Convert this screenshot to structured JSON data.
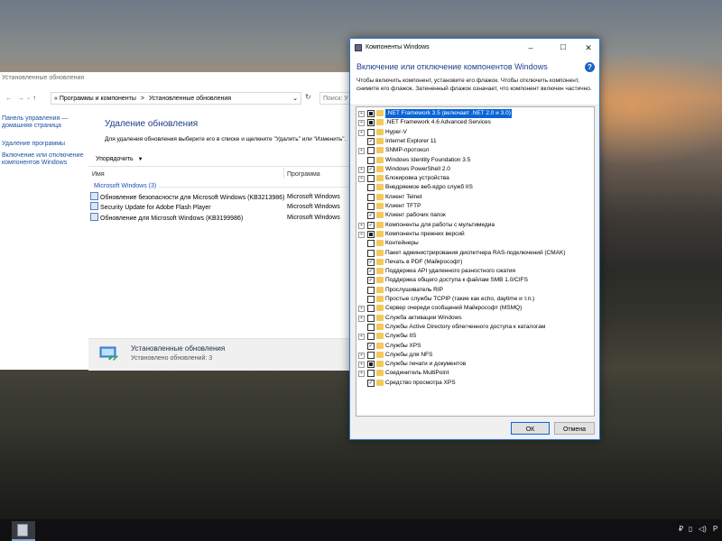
{
  "control_panel": {
    "window_title": "Установленные обновления",
    "breadcrumb_prefix": "«",
    "breadcrumb_1": "Программы и компоненты",
    "breadcrumb_sep": ">",
    "breadcrumb_2": "Установленные обновления",
    "search_placeholder": "Поиск: У",
    "side_links": [
      "Панель управления — домашняя страница",
      "Удаление программы",
      "Включение или отключение компонентов Windows"
    ],
    "heading": "Удаление обновления",
    "description": "Для удаления обновления выберите его в списке и щелкните \"Удалить\" или \"Изменить\".",
    "organize_label": "Упорядочить",
    "columns": {
      "name": "Имя",
      "program": "Программа"
    },
    "group_label": "Microsoft Windows (3)",
    "rows": [
      {
        "name": "Обновление безопасности для Microsoft Windows (KB3213986)",
        "program": "Microsoft Windows"
      },
      {
        "name": "Security Update for Adobe Flash Player",
        "program": "Microsoft Windows"
      },
      {
        "name": "Обновление для Microsoft Windows (KB3199986)",
        "program": "Microsoft Windows"
      }
    ],
    "details": {
      "title": "Установленные обновления",
      "subtitle": "Установлено обновлений: 3"
    }
  },
  "dialog": {
    "title": "Компоненты Windows",
    "heading": "Включение или отключение компонентов Windows",
    "description": "Чтобы включить компонент, установите его флажок. Чтобы отключить компонент, снимите его флажок. Затененный флажок означает, что компонент включен частично.",
    "help_glyph": "?",
    "features": [
      {
        "label": ".NET Framework 3.5 (включает .NET 2.0 и 3.0)",
        "state": "partial",
        "expandable": true,
        "selected": true
      },
      {
        "label": ".NET Framework 4.6 Advanced Services",
        "state": "partial",
        "expandable": true
      },
      {
        "label": "Hyper-V",
        "state": "unchecked",
        "expandable": true
      },
      {
        "label": "Internet Explorer 11",
        "state": "checked",
        "expandable": false
      },
      {
        "label": "SNMP-протокол",
        "state": "unchecked",
        "expandable": true
      },
      {
        "label": "Windows Identity Foundation 3.5",
        "state": "unchecked",
        "expandable": false
      },
      {
        "label": "Windows PowerShell 2.0",
        "state": "checked",
        "expandable": true
      },
      {
        "label": "Блокировка устройства",
        "state": "unchecked",
        "expandable": true
      },
      {
        "label": "Внедряемое веб-ядро служб IIS",
        "state": "unchecked",
        "expandable": false
      },
      {
        "label": "Клиент Telnet",
        "state": "unchecked",
        "expandable": false
      },
      {
        "label": "Клиент TFTP",
        "state": "unchecked",
        "expandable": false
      },
      {
        "label": "Клиент рабочих папок",
        "state": "checked",
        "expandable": false
      },
      {
        "label": "Компоненты для работы с мультимедиа",
        "state": "checked",
        "expandable": true
      },
      {
        "label": "Компоненты прежних версий",
        "state": "partial",
        "expandable": true
      },
      {
        "label": "Контейнеры",
        "state": "unchecked",
        "expandable": false
      },
      {
        "label": "Пакет администрирования диспетчера RAS-подключений (CMAK)",
        "state": "unchecked",
        "expandable": false
      },
      {
        "label": "Печать в PDF (Майкрософт)",
        "state": "checked",
        "expandable": false
      },
      {
        "label": "Поддержка API удаленного разностного сжатия",
        "state": "checked",
        "expandable": false
      },
      {
        "label": "Поддержка общего доступа к файлам SMB 1.0/CIFS",
        "state": "checked",
        "expandable": false
      },
      {
        "label": "Прослушиватель RIP",
        "state": "unchecked",
        "expandable": false
      },
      {
        "label": "Простые службы TCPIP (такие как echo, daytime и т.п.)",
        "state": "unchecked",
        "expandable": false
      },
      {
        "label": "Сервер очереди сообщений Майкрософт (MSMQ)",
        "state": "unchecked",
        "expandable": true
      },
      {
        "label": "Служба активации Windows",
        "state": "unchecked",
        "expandable": true
      },
      {
        "label": "Службы Active Directory облегченного доступа к каталогам",
        "state": "unchecked",
        "expandable": false
      },
      {
        "label": "Службы IIS",
        "state": "unchecked",
        "expandable": true
      },
      {
        "label": "Службы XPS",
        "state": "checked",
        "expandable": false
      },
      {
        "label": "Службы для NFS",
        "state": "unchecked",
        "expandable": true
      },
      {
        "label": "Службы печати и документов",
        "state": "partial",
        "expandable": true
      },
      {
        "label": "Соединитель MultiPoint",
        "state": "unchecked",
        "expandable": true
      },
      {
        "label": "Средство просмотра XPS",
        "state": "checked",
        "expandable": false
      }
    ],
    "ok_label": "ОК",
    "cancel_label": "Отмена"
  },
  "taskbar": {
    "tray_glyphs": [
      "₽",
      "▯",
      "◁)",
      "Р"
    ]
  },
  "colors": {
    "accent": "#0a64d8",
    "folder": "#f4c95a",
    "link": "#1a53a0",
    "heading": "#1e3d8f"
  }
}
